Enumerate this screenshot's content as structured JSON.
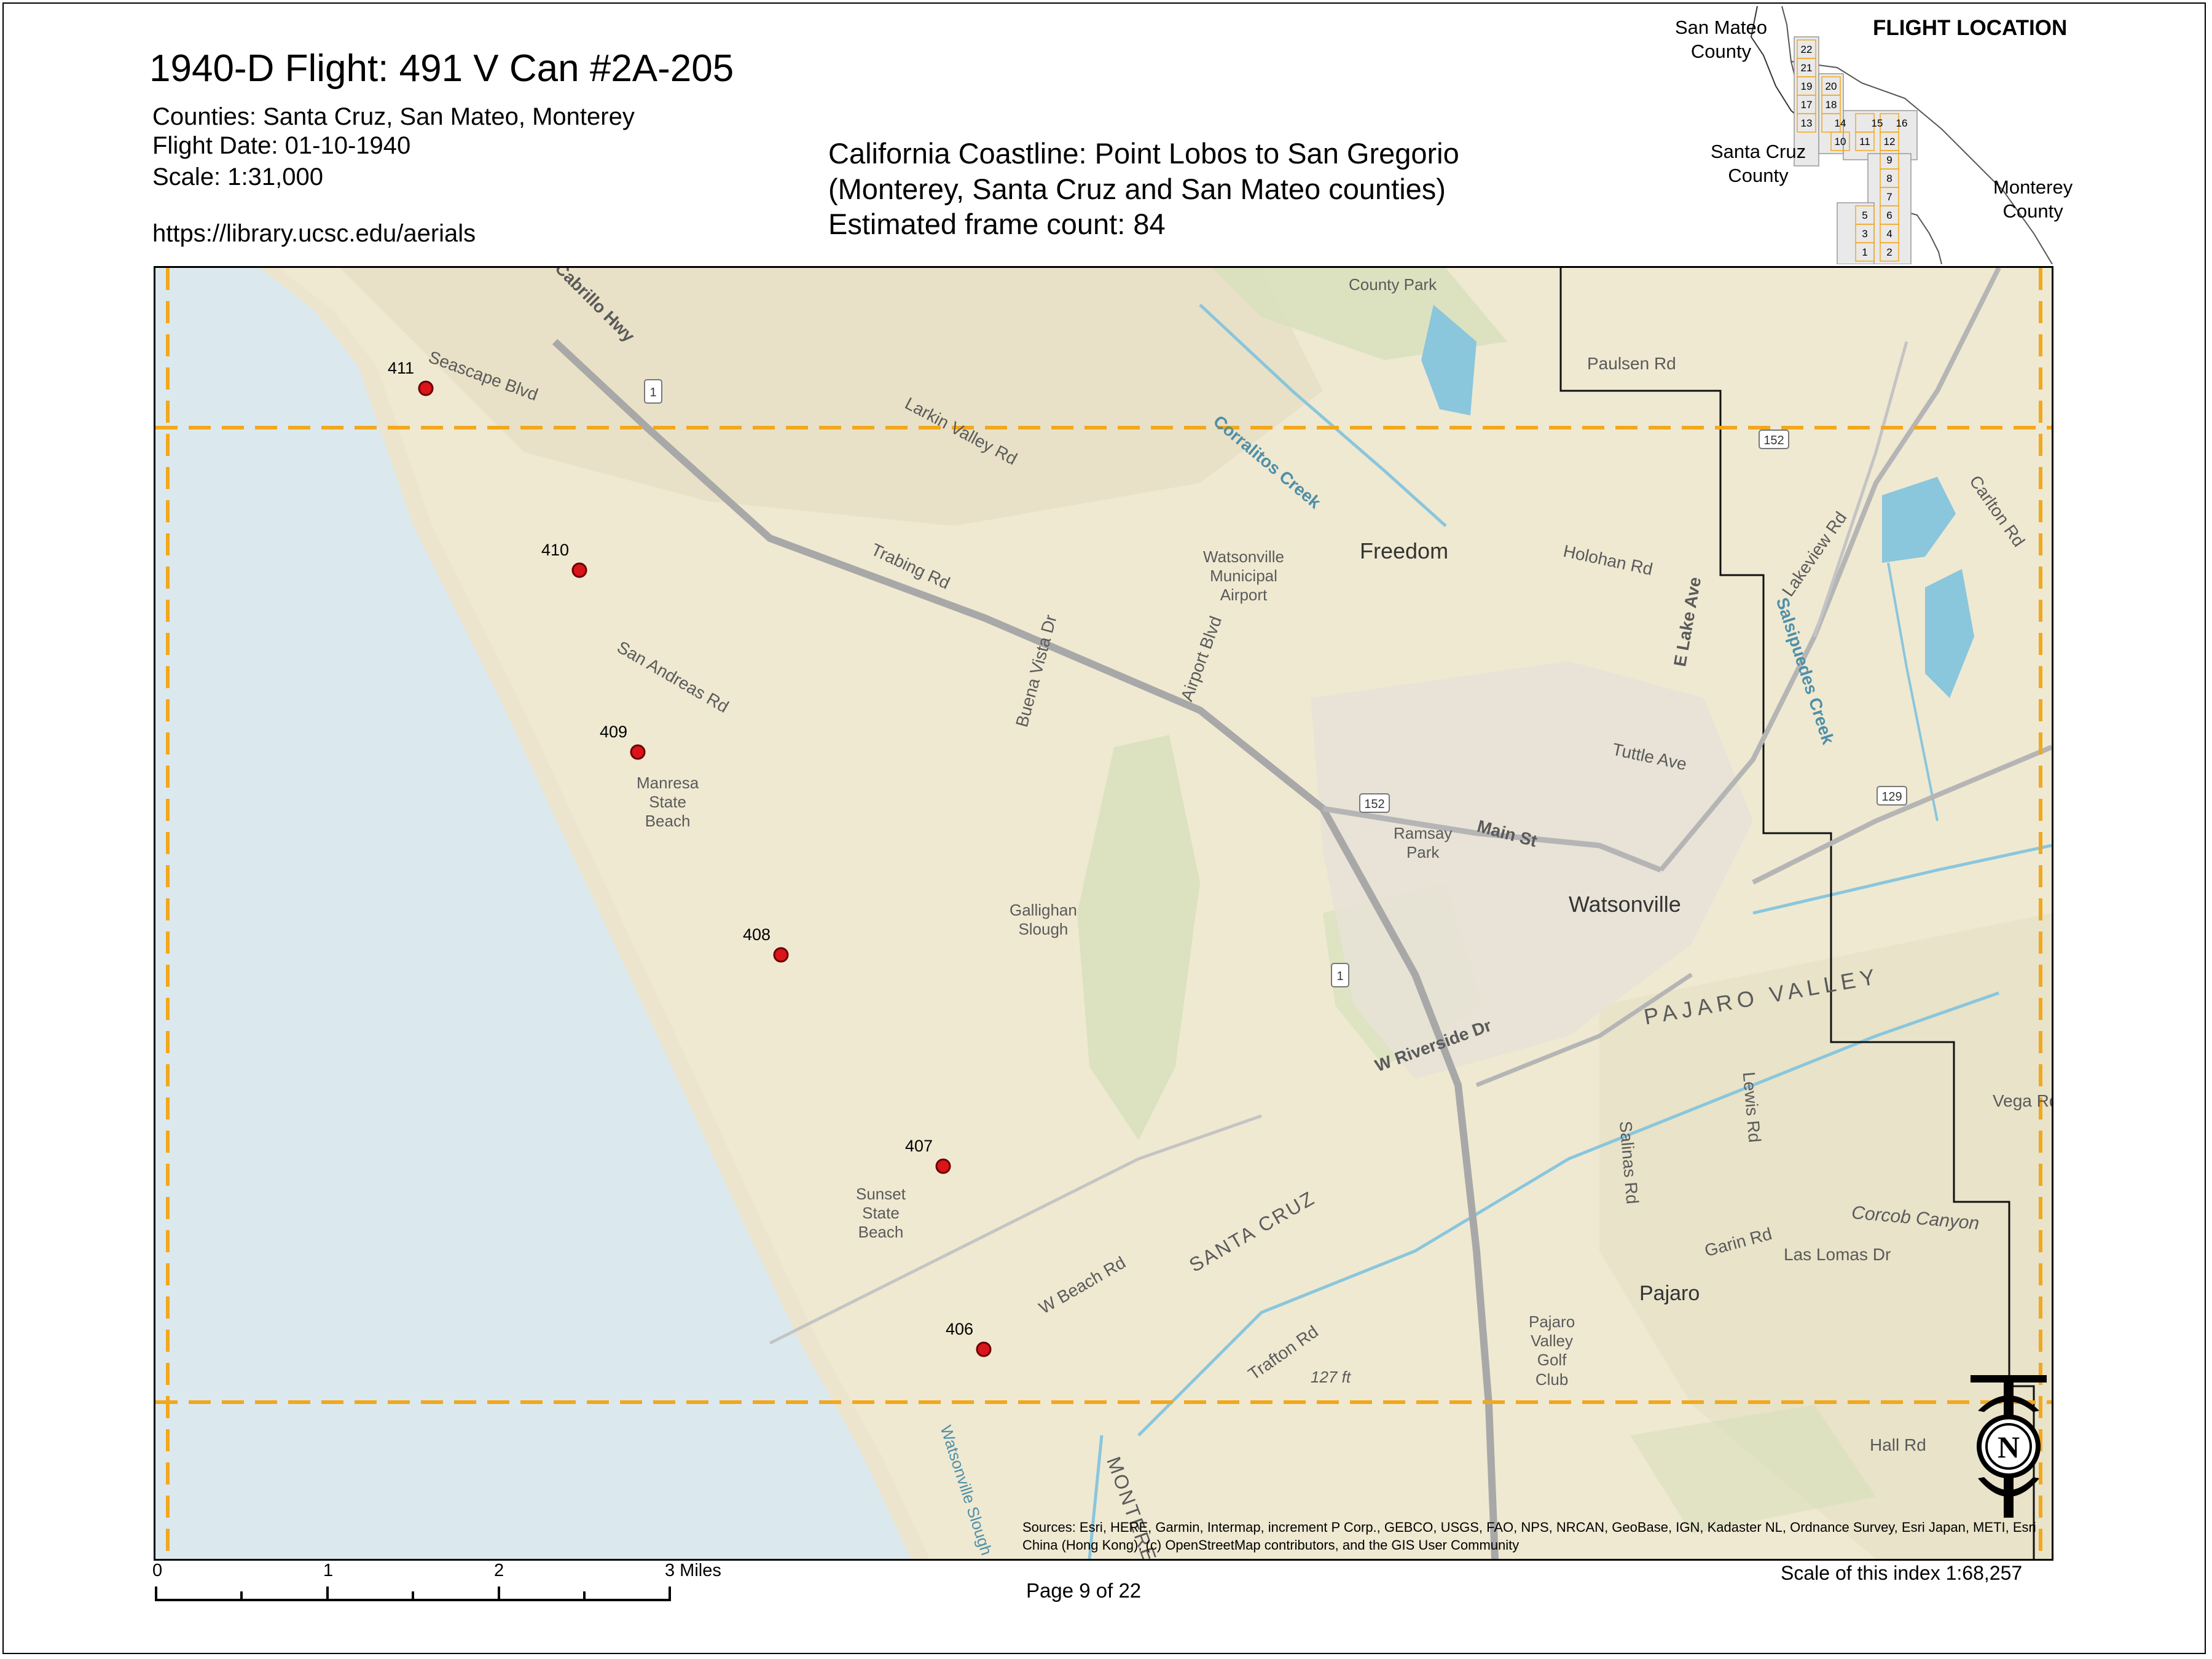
{
  "header": {
    "title": "1940-D Flight: 491 V Can #2A-205",
    "counties": "Counties: Santa Cruz, San Mateo, Monterey",
    "flight_date": "Flight Date: 01-10-1940",
    "scale": "Scale: 1:31,000",
    "url": "https://library.ucsc.edu/aerials"
  },
  "center_info": {
    "line1": "California Coastline: Point Lobos to San Gregorio",
    "line2": "(Monterey, Santa Cruz and San Mateo counties)",
    "line3": "Estimated frame count: 84"
  },
  "inset": {
    "title": "FLIGHT LOCATION",
    "san_mateo_1": "San Mateo",
    "san_mateo_2": "County",
    "santa_cruz_1": "Santa Cruz",
    "santa_cruz_2": "County",
    "monterey_1": "Monterey",
    "monterey_2": "County",
    "grid_numbers": [
      "22",
      "21",
      "19",
      "20",
      "17",
      "18",
      "13",
      "14",
      "15",
      "16",
      "10",
      "11",
      "12",
      "9",
      "8",
      "7",
      "5",
      "6",
      "3",
      "4",
      "1",
      "2"
    ]
  },
  "frames": [
    {
      "label": "411"
    },
    {
      "label": "410"
    },
    {
      "label": "409"
    },
    {
      "label": "408"
    },
    {
      "label": "407"
    },
    {
      "label": "406"
    }
  ],
  "map_labels": {
    "freedom": "Freedom",
    "watsonville": "Watsonville",
    "pajaro_valley": "PAJARO VALLEY",
    "pajaro": "Pajaro",
    "santa_cruz": "SANTA CRUZ",
    "monterey": "MONTEREY",
    "airport_1": "Watsonville",
    "airport_2": "Municipal",
    "airport_3": "Airport",
    "manresa_1": "Manresa",
    "manresa_2": "State",
    "manresa_3": "Beach",
    "sunset_1": "Sunset",
    "sunset_2": "State",
    "sunset_3": "Beach",
    "galligan_1": "Gallighan",
    "galligan_2": "Slough",
    "ramsay_1": "Ramsay",
    "ramsay_2": "Park",
    "golf_1": "Pajaro",
    "golf_2": "Valley",
    "golf_3": "Golf",
    "golf_4": "Club",
    "county_park": "County Park",
    "paulsen_rd": "Paulsen Rd",
    "holohan_rd": "Holohan Rd",
    "main_st": "Main St",
    "w_beach_rd": "W Beach Rd",
    "trafton_rd": "Trafton Rd",
    "san_andreas_rd": "San Andreas Rd",
    "larkin_valley_rd": "Larkin Valley Rd",
    "trabing_rd": "Trabing Rd",
    "buena_vista_dr": "Buena Vista Dr",
    "airport_blvd": "Airport Blvd",
    "corralitos_creek": "Corralitos Creek",
    "salsipuedes_creek": "Salsipuedes Creek",
    "e_lake_ave": "E Lake Ave",
    "tuttle_ave": "Tuttle Ave",
    "w_riverside_dr": "W Riverside Dr",
    "salinas_rd": "Salinas Rd",
    "lewis_rd": "Lewis Rd",
    "garin_rd": "Garin Rd",
    "las_lomas_dr": "Las Lomas Dr",
    "hall_rd": "Hall Rd",
    "vega_rd": "Vega Rd",
    "carlton_rd": "Carlton Rd",
    "lakeview_rd": "Lakeview Rd",
    "corcoran_canyon": "Corcob Canyon",
    "seascape_blvd": "Seascape Blvd",
    "elevation": "127 ft",
    "cabrillo_hwy": "Cabrillo Hwy",
    "watsonville_slough": "Watsonville Slough",
    "hwy_1a": "1",
    "hwy_1b": "1",
    "hwy_152a": "152",
    "hwy_152b": "152",
    "hwy_129": "129"
  },
  "sources": "Sources: Esri, HERE, Garmin, Intermap, increment P Corp., GEBCO, USGS, FAO, NPS, NRCAN, GeoBase, IGN, Kadaster NL, Ordnance Survey, Esri Japan, METI, Esri China (Hong Kong), (c) OpenStreetMap contributors, and the GIS User Community",
  "scalebar": {
    "t0": "0",
    "t1": "1",
    "t2": "2",
    "t3": "3 Miles"
  },
  "page": "Page 9 of 22",
  "scale_index": "Scale of this index 1:68,257",
  "north_arrow": "N",
  "colors": {
    "ocean": "#dbe9ee",
    "land": "#efe9d2",
    "flight_box": "#f2a81d",
    "frame_point": "#d9141a",
    "water": "#8ac6dc"
  }
}
